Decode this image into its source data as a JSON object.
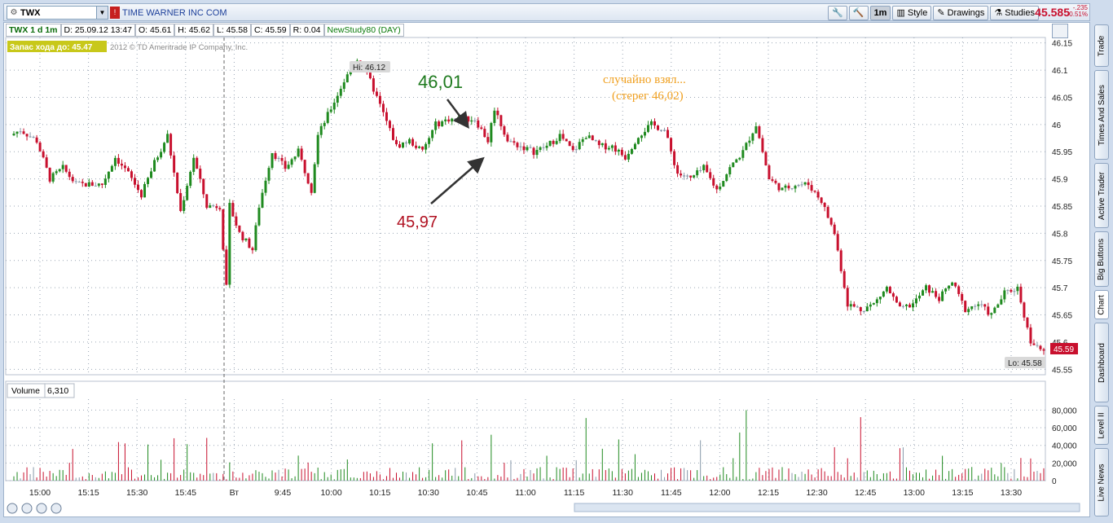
{
  "topbar": {
    "symbol": "TWX",
    "company": "TIME WARNER INC COM",
    "buttons": [
      "1m",
      "Style",
      "Drawings",
      "Studies"
    ],
    "last_price": "45.585",
    "change": "-.235",
    "change_pct": "-0.51%"
  },
  "side_tabs": [
    "Trade",
    "Times And Sales",
    "Active Trader",
    "Big Buttons",
    "Chart",
    "Dashboard",
    "Level II",
    "Live News"
  ],
  "infobar": {
    "title": "TWX 1 d 1m",
    "date": "D: 25.09.12 13:47",
    "open": "O: 45.61",
    "high": "H: 45.62",
    "low": "L: 45.58",
    "close": "C: 45.59",
    "range": "R: 0.04",
    "study": "NewStudy80 (DAY)"
  },
  "reserve_label": "Запас хода до: 45.47",
  "copyright": "2012 © TD Ameritrade IP Company, Inc.",
  "annotations": {
    "high_marker": "Hi: 46.12",
    "low_marker": "Lo: 45.58",
    "last_marker": "45.59",
    "green_note": "46,01",
    "red_note": "45,97",
    "orange_note_line1": "случайно взял...",
    "orange_note_line2": "(стерег 46,02)"
  },
  "volume_panel": {
    "label": "Volume",
    "value": "6,310"
  },
  "colors": {
    "up": "#1f8a1f",
    "down": "#c8102e",
    "neutral": "#8899aa",
    "grid": "#9aa6b4",
    "orange": "#f0a020"
  },
  "chart_data": {
    "type": "candlestick",
    "price_axis": {
      "ticks": [
        "46.15",
        "46.1",
        "46.05",
        "46",
        "45.95",
        "45.9",
        "45.85",
        "45.8",
        "45.75",
        "45.7",
        "45.65",
        "45.6",
        "45.55"
      ],
      "range": [
        45.54,
        46.16
      ]
    },
    "volume_axis": {
      "ticks": [
        "80,000",
        "60,000",
        "40,000",
        "20,000",
        "0"
      ],
      "range": [
        0,
        85000
      ]
    },
    "time_axis": {
      "ticks": [
        "15:00",
        "15:15",
        "15:30",
        "15:45",
        "Вт",
        "9:45",
        "10:00",
        "10:15",
        "10:30",
        "10:45",
        "11:00",
        "11:15",
        "11:30",
        "11:45",
        "12:00",
        "12:15",
        "12:30",
        "12:45",
        "13:00",
        "13:15",
        "13:30"
      ]
    },
    "price_path": [
      [
        0,
        45.98
      ],
      [
        3,
        45.99
      ],
      [
        8,
        45.97
      ],
      [
        12,
        45.9
      ],
      [
        16,
        45.92
      ],
      [
        20,
        45.89
      ],
      [
        28,
        45.89
      ],
      [
        32,
        45.94
      ],
      [
        36,
        45.91
      ],
      [
        40,
        45.87
      ],
      [
        44,
        45.93
      ],
      [
        48,
        45.98
      ],
      [
        52,
        45.84
      ],
      [
        56,
        45.94
      ],
      [
        60,
        45.85
      ],
      [
        64,
        45.85
      ],
      [
        66,
        45.7
      ],
      [
        67,
        45.85
      ],
      [
        70,
        45.8
      ],
      [
        74,
        45.77
      ],
      [
        76,
        45.85
      ],
      [
        80,
        45.95
      ],
      [
        84,
        45.92
      ],
      [
        88,
        45.95
      ],
      [
        92,
        45.88
      ],
      [
        94,
        45.98
      ],
      [
        98,
        46.03
      ],
      [
        102,
        46.08
      ],
      [
        106,
        46.12
      ],
      [
        110,
        46.08
      ],
      [
        114,
        46.02
      ],
      [
        118,
        45.96
      ],
      [
        122,
        45.97
      ],
      [
        126,
        45.95
      ],
      [
        130,
        46
      ],
      [
        134,
        46.01
      ],
      [
        138,
        46.01
      ],
      [
        142,
        46.01
      ],
      [
        146,
        45.97
      ],
      [
        148,
        46.03
      ],
      [
        152,
        45.97
      ],
      [
        156,
        45.96
      ],
      [
        160,
        45.95
      ],
      [
        164,
        45.96
      ],
      [
        168,
        45.98
      ],
      [
        172,
        45.95
      ],
      [
        176,
        45.98
      ],
      [
        180,
        45.96
      ],
      [
        184,
        45.96
      ],
      [
        188,
        45.94
      ],
      [
        192,
        45.98
      ],
      [
        196,
        46
      ],
      [
        200,
        45.99
      ],
      [
        204,
        45.91
      ],
      [
        208,
        45.9
      ],
      [
        212,
        45.92
      ],
      [
        216,
        45.88
      ],
      [
        220,
        45.92
      ],
      [
        224,
        45.95
      ],
      [
        228,
        46
      ],
      [
        232,
        45.9
      ],
      [
        236,
        45.88
      ],
      [
        240,
        45.89
      ],
      [
        244,
        45.89
      ],
      [
        248,
        45.86
      ],
      [
        252,
        45.8
      ],
      [
        256,
        45.67
      ],
      [
        260,
        45.66
      ],
      [
        264,
        45.67
      ],
      [
        268,
        45.7
      ],
      [
        272,
        45.66
      ],
      [
        276,
        45.67
      ],
      [
        280,
        45.7
      ],
      [
        284,
        45.68
      ],
      [
        288,
        45.71
      ],
      [
        292,
        45.66
      ],
      [
        296,
        45.67
      ],
      [
        300,
        45.65
      ],
      [
        304,
        45.69
      ],
      [
        308,
        45.7
      ],
      [
        312,
        45.6
      ],
      [
        316,
        45.58
      ]
    ],
    "volume_note": "per-bar volume bars, mostly 0-20,000 with spikes up to ~80,000",
    "grid": true
  }
}
